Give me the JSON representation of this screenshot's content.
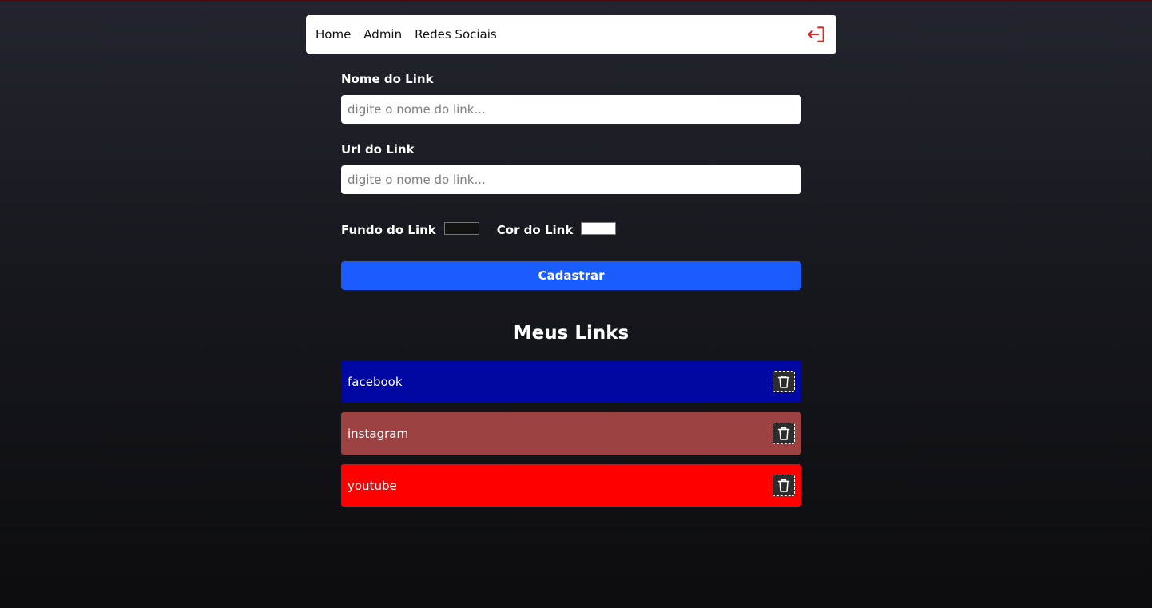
{
  "nav": {
    "items": [
      {
        "label": "Home"
      },
      {
        "label": "Admin"
      },
      {
        "label": "Redes Sociais"
      }
    ],
    "logout_icon": "logout-icon",
    "logout_icon_color": "#d32f2f"
  },
  "form": {
    "name_label": "Nome do Link",
    "name_placeholder": "digite o nome do link...",
    "name_value": "",
    "url_label": "Url do Link",
    "url_placeholder": "digite o nome do link...",
    "url_value": "",
    "background_label": "Fundo do Link",
    "background_color": "#121212",
    "text_color_label": "Cor do Link",
    "text_color": "#ffffff",
    "submit_label": "Cadastrar",
    "submit_color": "#1b5cff"
  },
  "links": {
    "title": "Meus Links",
    "items": [
      {
        "name": "facebook",
        "background": "#0008a3",
        "color": "#ffffff"
      },
      {
        "name": "instagram",
        "background": "#9c4242",
        "color": "#ffffff"
      },
      {
        "name": "youtube",
        "background": "#ff0000",
        "color": "#ffffff"
      }
    ],
    "delete_icon": "trash-icon"
  }
}
